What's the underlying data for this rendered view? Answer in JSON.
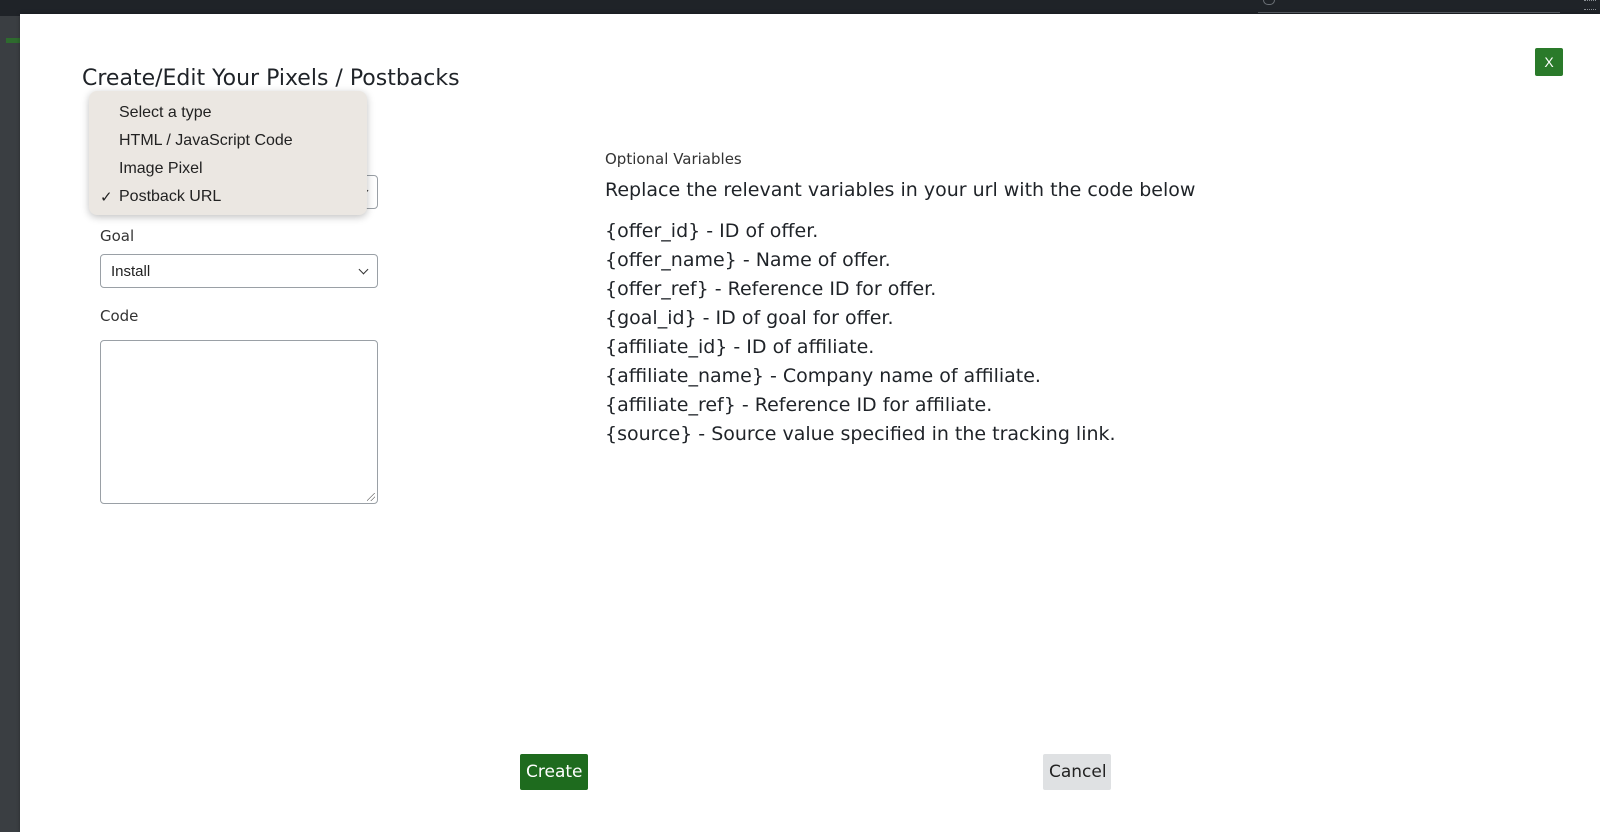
{
  "modal": {
    "title": "Create/Edit Your Pixels / Postbacks",
    "close_label": "X"
  },
  "form": {
    "goal_label": "Goal",
    "goal_value": "Install",
    "code_label": "Code",
    "code_value": ""
  },
  "type_dropdown": {
    "options": [
      {
        "label": "Select a type",
        "selected": false
      },
      {
        "label": "HTML / JavaScript Code",
        "selected": false
      },
      {
        "label": "Image Pixel",
        "selected": false
      },
      {
        "label": "Postback URL",
        "selected": true
      }
    ],
    "check_mark": "✓"
  },
  "variables": {
    "heading": "Optional Variables",
    "intro": "Replace the relevant variables in your url with the code below",
    "items": [
      "{offer_id} - ID of offer.",
      "{offer_name} - Name of offer.",
      "{offer_ref} - Reference ID for offer.",
      "{goal_id} - ID of goal for offer.",
      "{affiliate_id} - ID of affiliate.",
      "{affiliate_name} - Company name of affiliate.",
      "{affiliate_ref} - Reference ID for affiliate.",
      "{source} - Source value specified in the tracking link."
    ]
  },
  "actions": {
    "create_label": "Create",
    "cancel_label": "Cancel"
  },
  "colors": {
    "primary_green": "#1e6b1e",
    "close_green": "#2a7a2a",
    "dropdown_bg": "#ebe7e2"
  }
}
